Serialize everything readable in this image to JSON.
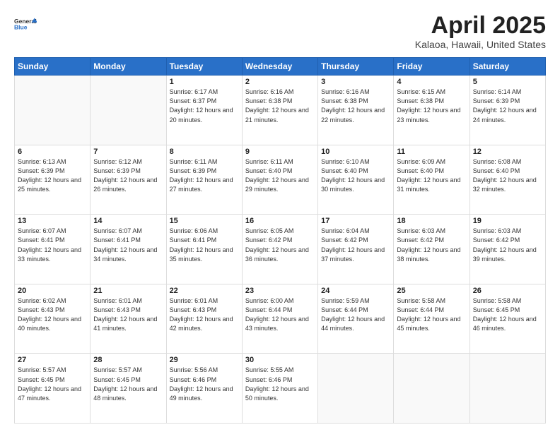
{
  "header": {
    "logo_general": "General",
    "logo_blue": "Blue",
    "title": "April 2025",
    "location": "Kalaoa, Hawaii, United States"
  },
  "days_of_week": [
    "Sunday",
    "Monday",
    "Tuesday",
    "Wednesday",
    "Thursday",
    "Friday",
    "Saturday"
  ],
  "weeks": [
    [
      {
        "day": "",
        "info": ""
      },
      {
        "day": "",
        "info": ""
      },
      {
        "day": "1",
        "info": "Sunrise: 6:17 AM\nSunset: 6:37 PM\nDaylight: 12 hours and 20 minutes."
      },
      {
        "day": "2",
        "info": "Sunrise: 6:16 AM\nSunset: 6:38 PM\nDaylight: 12 hours and 21 minutes."
      },
      {
        "day": "3",
        "info": "Sunrise: 6:16 AM\nSunset: 6:38 PM\nDaylight: 12 hours and 22 minutes."
      },
      {
        "day": "4",
        "info": "Sunrise: 6:15 AM\nSunset: 6:38 PM\nDaylight: 12 hours and 23 minutes."
      },
      {
        "day": "5",
        "info": "Sunrise: 6:14 AM\nSunset: 6:39 PM\nDaylight: 12 hours and 24 minutes."
      }
    ],
    [
      {
        "day": "6",
        "info": "Sunrise: 6:13 AM\nSunset: 6:39 PM\nDaylight: 12 hours and 25 minutes."
      },
      {
        "day": "7",
        "info": "Sunrise: 6:12 AM\nSunset: 6:39 PM\nDaylight: 12 hours and 26 minutes."
      },
      {
        "day": "8",
        "info": "Sunrise: 6:11 AM\nSunset: 6:39 PM\nDaylight: 12 hours and 27 minutes."
      },
      {
        "day": "9",
        "info": "Sunrise: 6:11 AM\nSunset: 6:40 PM\nDaylight: 12 hours and 29 minutes."
      },
      {
        "day": "10",
        "info": "Sunrise: 6:10 AM\nSunset: 6:40 PM\nDaylight: 12 hours and 30 minutes."
      },
      {
        "day": "11",
        "info": "Sunrise: 6:09 AM\nSunset: 6:40 PM\nDaylight: 12 hours and 31 minutes."
      },
      {
        "day": "12",
        "info": "Sunrise: 6:08 AM\nSunset: 6:40 PM\nDaylight: 12 hours and 32 minutes."
      }
    ],
    [
      {
        "day": "13",
        "info": "Sunrise: 6:07 AM\nSunset: 6:41 PM\nDaylight: 12 hours and 33 minutes."
      },
      {
        "day": "14",
        "info": "Sunrise: 6:07 AM\nSunset: 6:41 PM\nDaylight: 12 hours and 34 minutes."
      },
      {
        "day": "15",
        "info": "Sunrise: 6:06 AM\nSunset: 6:41 PM\nDaylight: 12 hours and 35 minutes."
      },
      {
        "day": "16",
        "info": "Sunrise: 6:05 AM\nSunset: 6:42 PM\nDaylight: 12 hours and 36 minutes."
      },
      {
        "day": "17",
        "info": "Sunrise: 6:04 AM\nSunset: 6:42 PM\nDaylight: 12 hours and 37 minutes."
      },
      {
        "day": "18",
        "info": "Sunrise: 6:03 AM\nSunset: 6:42 PM\nDaylight: 12 hours and 38 minutes."
      },
      {
        "day": "19",
        "info": "Sunrise: 6:03 AM\nSunset: 6:42 PM\nDaylight: 12 hours and 39 minutes."
      }
    ],
    [
      {
        "day": "20",
        "info": "Sunrise: 6:02 AM\nSunset: 6:43 PM\nDaylight: 12 hours and 40 minutes."
      },
      {
        "day": "21",
        "info": "Sunrise: 6:01 AM\nSunset: 6:43 PM\nDaylight: 12 hours and 41 minutes."
      },
      {
        "day": "22",
        "info": "Sunrise: 6:01 AM\nSunset: 6:43 PM\nDaylight: 12 hours and 42 minutes."
      },
      {
        "day": "23",
        "info": "Sunrise: 6:00 AM\nSunset: 6:44 PM\nDaylight: 12 hours and 43 minutes."
      },
      {
        "day": "24",
        "info": "Sunrise: 5:59 AM\nSunset: 6:44 PM\nDaylight: 12 hours and 44 minutes."
      },
      {
        "day": "25",
        "info": "Sunrise: 5:58 AM\nSunset: 6:44 PM\nDaylight: 12 hours and 45 minutes."
      },
      {
        "day": "26",
        "info": "Sunrise: 5:58 AM\nSunset: 6:45 PM\nDaylight: 12 hours and 46 minutes."
      }
    ],
    [
      {
        "day": "27",
        "info": "Sunrise: 5:57 AM\nSunset: 6:45 PM\nDaylight: 12 hours and 47 minutes."
      },
      {
        "day": "28",
        "info": "Sunrise: 5:57 AM\nSunset: 6:45 PM\nDaylight: 12 hours and 48 minutes."
      },
      {
        "day": "29",
        "info": "Sunrise: 5:56 AM\nSunset: 6:46 PM\nDaylight: 12 hours and 49 minutes."
      },
      {
        "day": "30",
        "info": "Sunrise: 5:55 AM\nSunset: 6:46 PM\nDaylight: 12 hours and 50 minutes."
      },
      {
        "day": "",
        "info": ""
      },
      {
        "day": "",
        "info": ""
      },
      {
        "day": "",
        "info": ""
      }
    ]
  ]
}
